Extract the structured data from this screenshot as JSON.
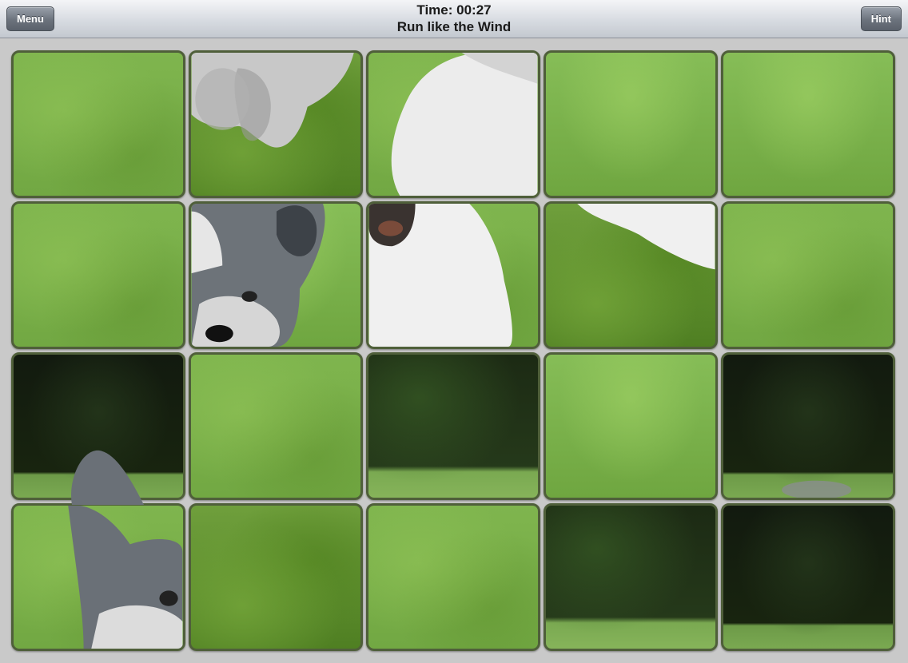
{
  "header": {
    "menu_label": "Menu",
    "hint_label": "Hint",
    "timer": "Time: 00:27",
    "puzzle_title": "Run like the Wind"
  },
  "board": {
    "rows": 4,
    "cols": 5,
    "tile_content": [
      [
        "grass",
        "dog-paws-over-bush",
        "white-dog-body",
        "grass",
        "grass"
      ],
      [
        "grass",
        "gray-dog-face",
        "white-dog-head",
        "bush-with-white-fur",
        "grass-bush"
      ],
      [
        "dark-background",
        "grass",
        "blurred-dark-bush",
        "grass",
        "dark-background-fur-tip"
      ],
      [
        "gray-dog-ear",
        "grass",
        "grass",
        "blurred-dark-bush",
        "dark-background"
      ]
    ]
  },
  "colors": {
    "tile_border": "#4f5f3a",
    "board_background": "#c9c9c9",
    "button_gray": "#6c737d"
  }
}
